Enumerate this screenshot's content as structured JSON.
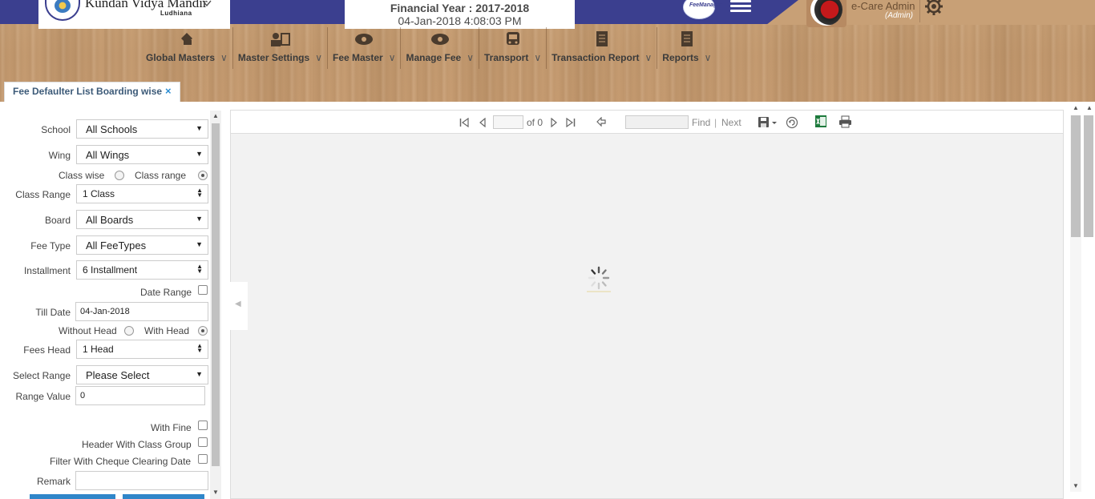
{
  "header": {
    "school_name": "Kundan Vidya Mandir",
    "school_city": "Ludhiana",
    "financial_year": "Financial Year : 2017-2018",
    "datetime": "04-Jan-2018 4:08:03 PM",
    "app_badge": "FeeManager",
    "user_name": "e-Care Admin",
    "user_role": "(Admin)",
    "colors": {
      "topbar": "#3b3f8f",
      "wood": "#c8a076"
    }
  },
  "nav": {
    "items": [
      {
        "label": "Global Masters",
        "icon": "global-masters-icon"
      },
      {
        "label": "Master Settings",
        "icon": "master-settings-icon"
      },
      {
        "label": "Fee Master",
        "icon": "fee-master-icon"
      },
      {
        "label": "Manage Fee",
        "icon": "manage-fee-icon"
      },
      {
        "label": "Transport",
        "icon": "bus-icon"
      },
      {
        "label": "Transaction Report",
        "icon": "report-icon"
      },
      {
        "label": "Reports",
        "icon": "report-icon"
      }
    ]
  },
  "tab": {
    "label": "Fee Defaulter List Boarding wise",
    "close": "×"
  },
  "form": {
    "school": {
      "label": "School",
      "value": "All Schools"
    },
    "wing": {
      "label": "Wing",
      "value": "All Wings"
    },
    "class_mode": {
      "option1": "Class wise",
      "option2": "Class range",
      "selected": "Class range"
    },
    "class_range": {
      "label": "Class Range",
      "value": "1 Class"
    },
    "board": {
      "label": "Board",
      "value": "All Boards"
    },
    "fee_type": {
      "label": "Fee Type",
      "value": "All FeeTypes"
    },
    "installment": {
      "label": "Installment",
      "value": "6 Installment"
    },
    "date_range": {
      "label": "Date Range",
      "checked": false
    },
    "till_date": {
      "label": "Till Date",
      "value": "04-Jan-2018"
    },
    "head_mode": {
      "option1": "Without Head",
      "option2": "With Head",
      "selected": "With Head"
    },
    "fees_head": {
      "label": "Fees Head",
      "value": "1 Head"
    },
    "select_range": {
      "label": "Select Range",
      "value": "Please Select"
    },
    "range_value": {
      "label": "Range Value",
      "value": "0"
    },
    "with_fine": {
      "label": "With Fine",
      "checked": false
    },
    "header_class_group": {
      "label": "Header With Class Group",
      "checked": false
    },
    "cheque_clearing": {
      "label": "Filter With Cheque Clearing Date",
      "checked": false
    },
    "remark": {
      "label": "Remark",
      "value": ""
    }
  },
  "viewer": {
    "page_input": "",
    "page_of": "of 0",
    "find_input": "",
    "find_label": "Find",
    "separator": "|",
    "next_label": "Next",
    "status": "loading"
  }
}
